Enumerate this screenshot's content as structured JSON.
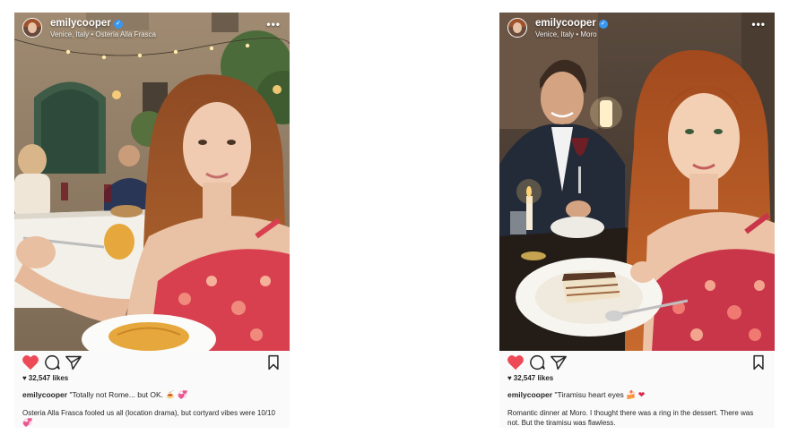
{
  "posts": [
    {
      "username": "emilycooper",
      "location": "Venice, Italy • Osteria Alla Frasca",
      "more_label": "•••",
      "likes": "32,547 likes",
      "caption_user": "emilycooper",
      "caption_line": "\"Totally not Rome... but OK.",
      "caption_emojis": [
        "🍝",
        "💞"
      ],
      "comment_text": "Osteria Alla Frasca fooled us all (location drama), but cortyard vibes were 10/10",
      "comment_emoji": "💞"
    },
    {
      "username": "emilycooper",
      "location": "Venice, Italy • Moro",
      "more_label": "•••",
      "likes": "32,547 likes",
      "caption_user": "emilycooper",
      "caption_line": "\"Tiramisu heart eyes",
      "caption_emojis": [
        "🍰",
        "❤"
      ],
      "comment_text": "Romantic dinner at Moro. I thought there was a ring in the dessert. There was not. But the tiramisu was flawless.",
      "comment_emoji": ""
    }
  ],
  "icons": {
    "verified": "verified-check-icon",
    "like": "heart-icon",
    "comment": "comment-bubble-icon",
    "share": "paper-plane-icon",
    "save": "bookmark-icon",
    "more": "more-dots-icon"
  },
  "colors": {
    "like_red": "#ed4956",
    "verified_blue": "#3897f0",
    "text": "#262626"
  }
}
